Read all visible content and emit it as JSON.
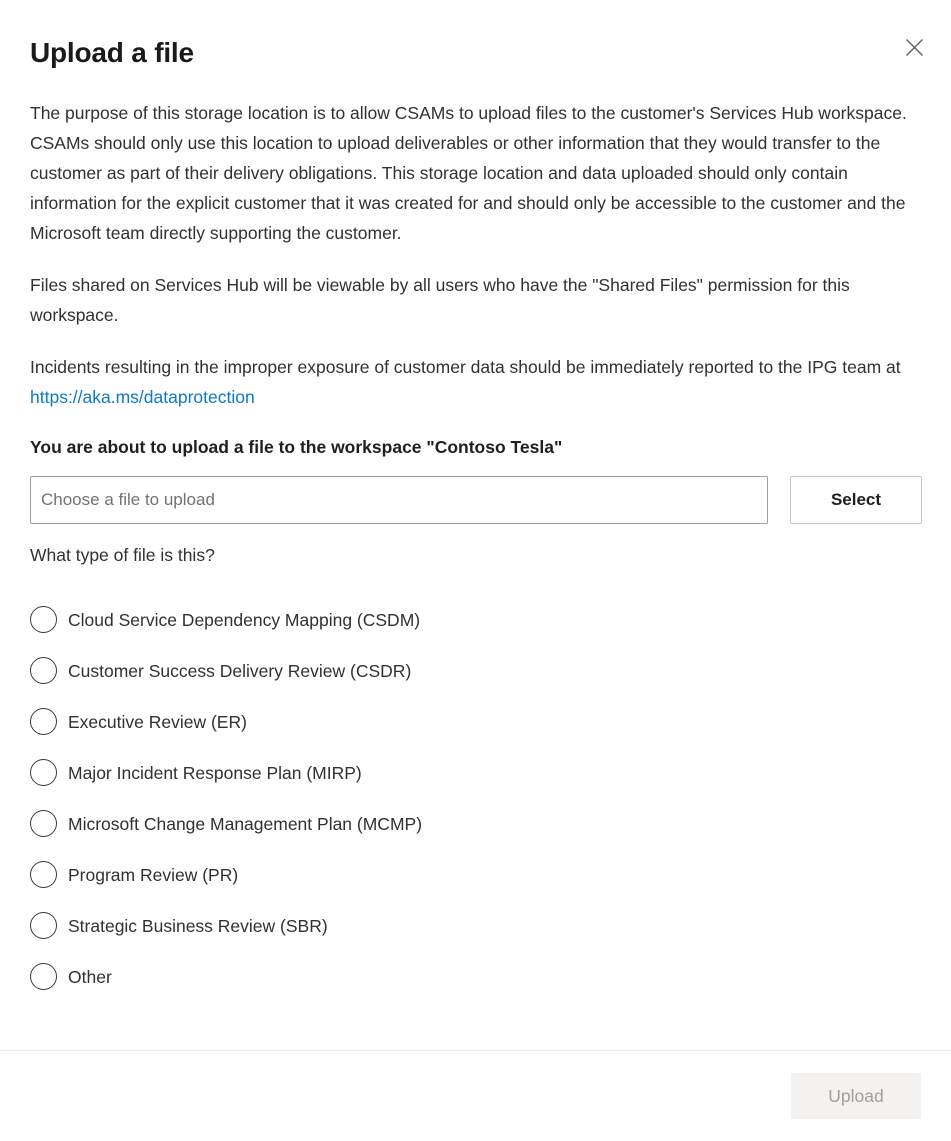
{
  "dialog": {
    "title": "Upload a file",
    "close_icon": "close-icon",
    "paragraphs": [
      "The purpose of this storage location is to allow CSAMs to upload files to the customer's Services Hub workspace. CSAMs should only use this location to upload deliverables or other information that they would transfer to the customer as part of their delivery obligations. This storage location and data uploaded should only contain information for the explicit customer that it was created for and should only be accessible to the customer and the Microsoft team directly supporting the customer.",
      "Files shared on Services Hub will be viewable by all users who have the \"Shared Files\" permission for this workspace."
    ],
    "incident_paragraph": {
      "prefix": "Incidents resulting in the improper exposure of customer data should be immediately reported to the IPG team at ",
      "link_text": "https://aka.ms/dataprotection",
      "link_color": "#0f79c3"
    },
    "workspace_line": "You are about to upload a file to the workspace \"Contoso Tesla\"",
    "file_field": {
      "value": "",
      "placeholder": "Choose a file to upload"
    },
    "select_button": "Select",
    "question": "What type of file is this?",
    "file_types": [
      {
        "label": "Cloud Service Dependency Mapping (CSDM)",
        "checked": false
      },
      {
        "label": "Customer Success Delivery Review (CSDR)",
        "checked": false
      },
      {
        "label": "Executive Review (ER)",
        "checked": false
      },
      {
        "label": "Major Incident Response Plan (MIRP)",
        "checked": false
      },
      {
        "label": "Microsoft Change Management Plan (MCMP)",
        "checked": false
      },
      {
        "label": "Program Review (PR)",
        "checked": false
      },
      {
        "label": "Strategic Business Review (SBR)",
        "checked": false
      },
      {
        "label": "Other",
        "checked": false
      }
    ],
    "footer": {
      "upload_button": "Upload",
      "upload_disabled": true
    }
  },
  "colors": {
    "text": "#323130",
    "link": "#0f79c3",
    "accent": "#0078d4",
    "disabled_bg": "#f3f2f1",
    "disabled_text": "#a19f9d",
    "border": "#a19f9d",
    "divider": "#edebe9"
  }
}
